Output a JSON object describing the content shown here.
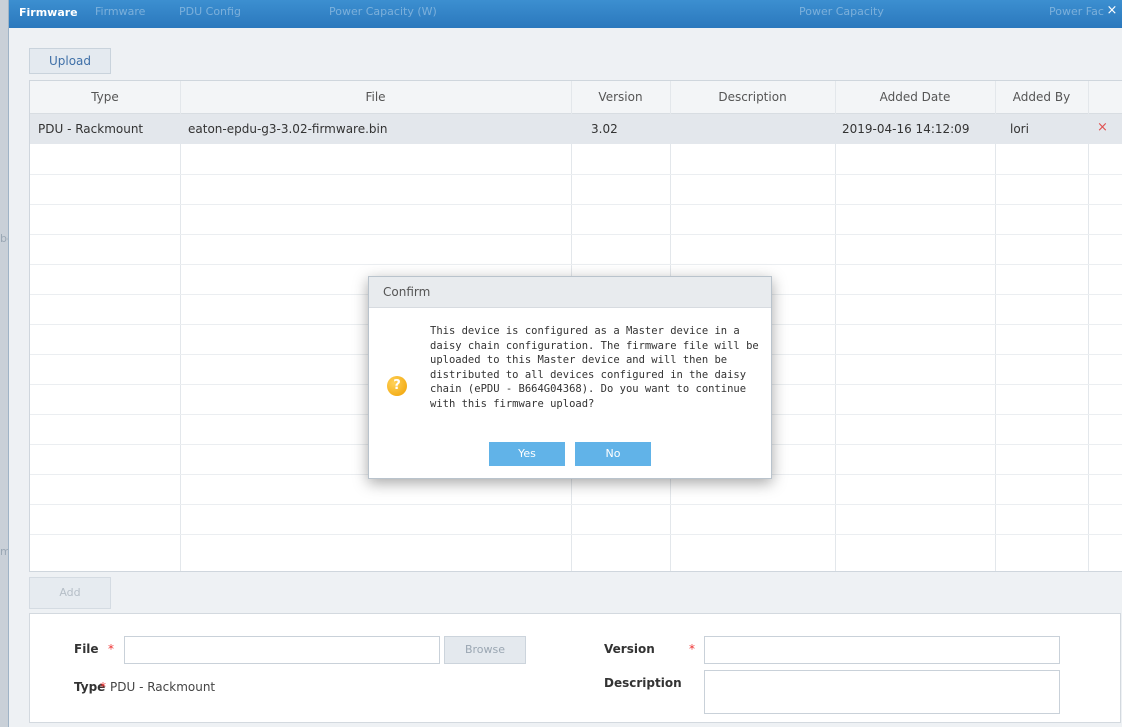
{
  "background": {
    "tabs": [
      "Firmware",
      "PDU Config",
      "Power Capacity (W)",
      "Power Capacity",
      "Power Fac"
    ],
    "edge_fragments": [
      "be",
      "m"
    ]
  },
  "window": {
    "title": "Firmware",
    "close_label": "×"
  },
  "toolbar": {
    "upload_label": "Upload"
  },
  "table": {
    "columns": [
      "Type",
      "File",
      "Version",
      "Description",
      "Added Date",
      "Added By"
    ],
    "rows": [
      {
        "type": "PDU - Rackmount",
        "file": "eaton-epdu-g3-3.02-firmware.bin",
        "version": "3.02",
        "description": "",
        "added_date": "2019-04-16 14:12:09",
        "added_by": "lori",
        "delete_label": "×"
      }
    ]
  },
  "add_label": "Add",
  "form": {
    "file_label": "File",
    "required_mark": "*",
    "file_value": "",
    "browse_label": "Browse",
    "version_label": "Version",
    "version_value": "",
    "type_label": "Type",
    "type_value": "PDU - Rackmount",
    "description_label": "Description",
    "description_value": ""
  },
  "dialog": {
    "title": "Confirm",
    "icon": "?",
    "message": "This device is configured as a Master device in a daisy chain configuration.  The firmware file will be uploaded to this Master device and will then be distributed to all devices configured in the daisy chain (ePDU - B664G04368).  Do you want to continue with this firmware upload?",
    "yes_label": "Yes",
    "no_label": "No"
  },
  "colors": {
    "titlebar": "#2b78bd",
    "dialog_button": "#61b3e8",
    "required": "#e33333",
    "delete": "#e05050"
  }
}
